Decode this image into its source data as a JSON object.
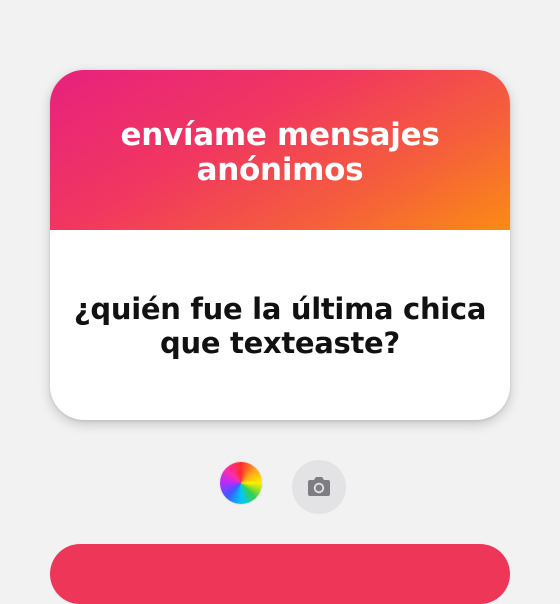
{
  "card": {
    "title": "envíame mensajes anónimos",
    "question": "¿quién fue la última chica que texteaste?"
  },
  "colors": {
    "gradient_start": "#e7217e",
    "gradient_end": "#fb8b14",
    "next_card": "#ee3659"
  },
  "controls": {
    "color_icon": "color-wheel-icon",
    "camera_icon": "camera-icon"
  }
}
